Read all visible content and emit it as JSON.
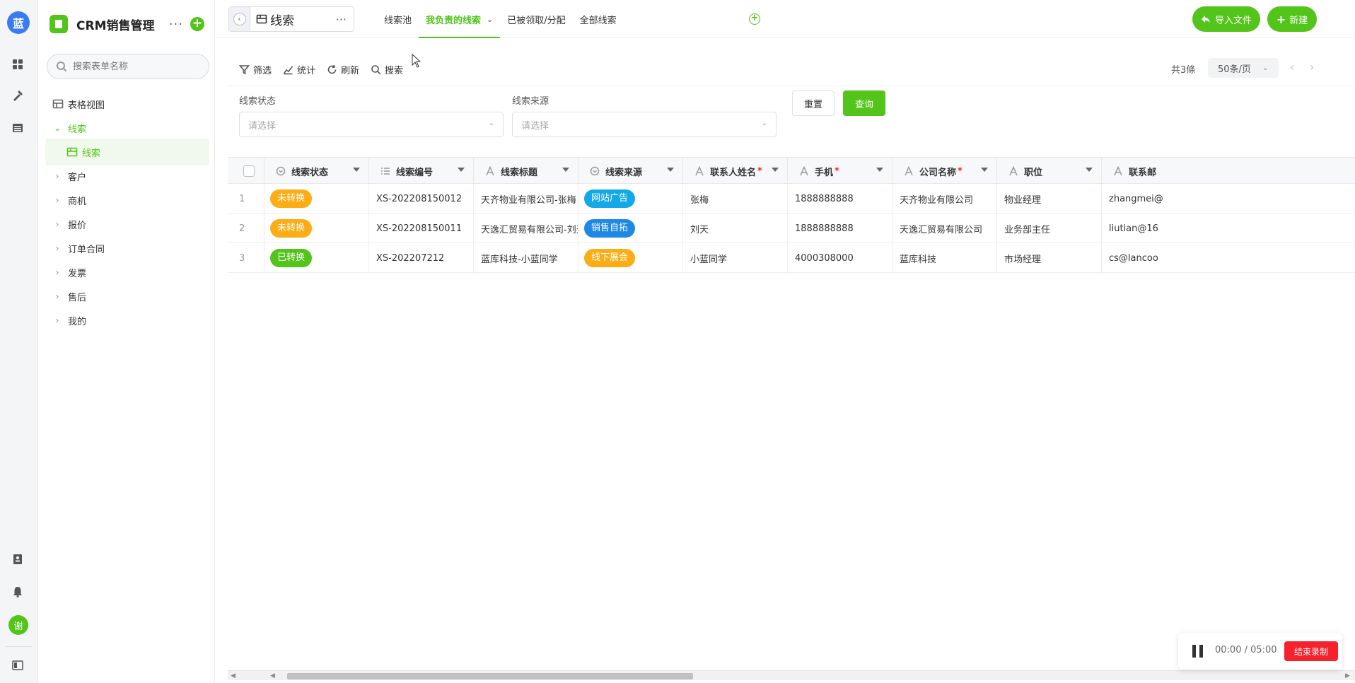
{
  "rail": {
    "logo": "蓝",
    "user": "谢"
  },
  "app": {
    "title": "CRM销售管理",
    "search_placeholder": "搜索表单名称"
  },
  "nav": {
    "items": [
      {
        "label": "表格视图"
      },
      {
        "label": "线索"
      },
      {
        "label": "线索"
      },
      {
        "label": "客户"
      },
      {
        "label": "商机"
      },
      {
        "label": "报价"
      },
      {
        "label": "订单合同"
      },
      {
        "label": "发票"
      },
      {
        "label": "售后"
      },
      {
        "label": "我的"
      }
    ]
  },
  "topbar": {
    "page_title": "线索",
    "tabs": [
      "线索池",
      "我负责的线索",
      "已被领取/分配",
      "全部线索"
    ],
    "import_label": "导入文件",
    "new_label": "新建"
  },
  "toolbar": {
    "filter": "筛选",
    "stats": "统计",
    "refresh": "刷新",
    "search": "搜索",
    "count": "共3條",
    "page_size": "50条/页"
  },
  "filters": {
    "status_label": "线索状态",
    "status_placeholder": "请选择",
    "source_label": "线索来源",
    "source_placeholder": "请选择",
    "reset": "重置",
    "query": "查询"
  },
  "table": {
    "columns": [
      {
        "label": "线索状态",
        "required": ""
      },
      {
        "label": "线索编号",
        "required": ""
      },
      {
        "label": "线索标题",
        "required": ""
      },
      {
        "label": "线索来源",
        "required": ""
      },
      {
        "label": "联系人姓名",
        "required": "*"
      },
      {
        "label": "手机",
        "required": "*"
      },
      {
        "label": "公司名称",
        "required": "*"
      },
      {
        "label": "职位",
        "required": ""
      },
      {
        "label": "联系邮",
        "required": ""
      }
    ],
    "rows": [
      {
        "idx": "1",
        "status": "未转换",
        "status_color": "#faad14",
        "code": "XS-202208150012",
        "title": "天齐物业有限公司-张梅",
        "source": "网站广告",
        "source_color": "#13a8e8",
        "contact": "张梅",
        "phone": "1888888888",
        "company": "天齐物业有限公司",
        "position": "物业经理",
        "email": "zhangmei@"
      },
      {
        "idx": "2",
        "status": "未转换",
        "status_color": "#faad14",
        "code": "XS-202208150011",
        "title": "天逸汇贸易有限公司-刘天",
        "source": "销售自拓",
        "source_color": "#1e88e5",
        "contact": "刘天",
        "phone": "1888888888",
        "company": "天逸汇贸易有限公司",
        "position": "业务部主任",
        "email": "liutian@16"
      },
      {
        "idx": "3",
        "status": "已转换",
        "status_color": "#52c41a",
        "code": "XS-202207212",
        "title": "蓝库科技-小蓝同学",
        "source": "线下展会",
        "source_color": "#faad14",
        "contact": "小蓝同学",
        "phone": "4000308000",
        "company": "蓝库科技",
        "position": "市场经理",
        "email": "cs@lancoo"
      }
    ]
  },
  "recorder": {
    "time": "00:00 / 05:00",
    "stop_label": "结束录制"
  }
}
